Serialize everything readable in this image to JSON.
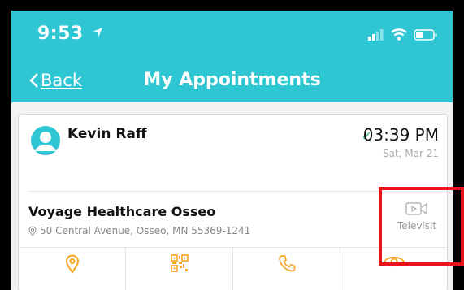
{
  "status_bar": {
    "time": "9:53",
    "icons": [
      "location-arrow-icon",
      "signal-icon",
      "wifi-icon",
      "battery-icon"
    ]
  },
  "nav": {
    "back_label": "Back",
    "title": "My Appointments"
  },
  "appointment": {
    "patient_name": "Kevin Raff",
    "time": "03:39 PM",
    "date": "Sat, Mar 21",
    "location_name": "Voyage Healthcare Osseo",
    "address": "50 Central Avenue, Osseo, MN 55369-1241",
    "visit_type": "Televisit",
    "actions": [
      "map-pin-icon",
      "qr-code-icon",
      "phone-icon",
      "eye-icon"
    ]
  },
  "colors": {
    "header": "#2ec6d3",
    "accent": "#f5a623",
    "highlight": "#e8131b",
    "check": "#3cb878"
  }
}
